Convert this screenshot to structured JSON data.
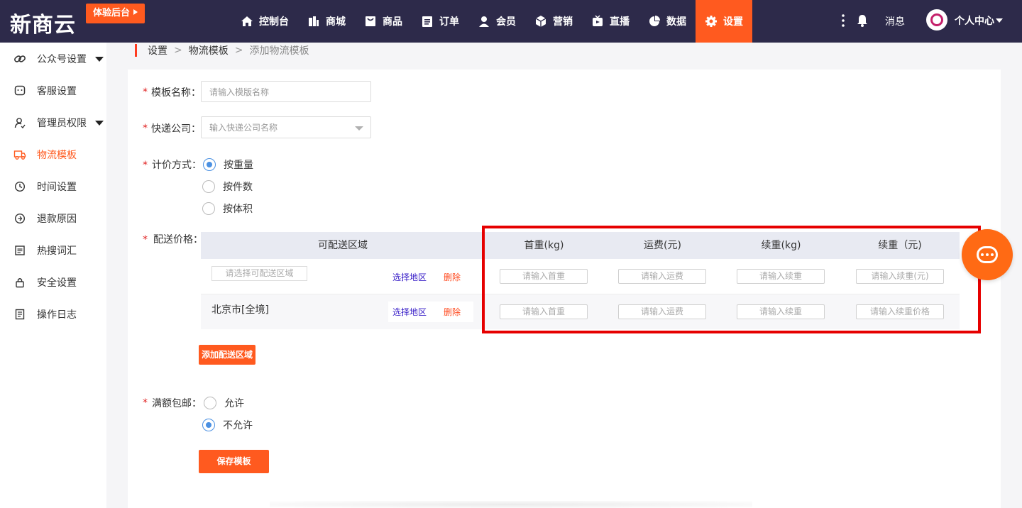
{
  "header": {
    "logo": "新商云",
    "trial_button": "体验后台",
    "nav": [
      {
        "label": "控制台",
        "icon": "home-icon"
      },
      {
        "label": "商城",
        "icon": "mall-icon"
      },
      {
        "label": "商品",
        "icon": "bag-icon"
      },
      {
        "label": "订单",
        "icon": "order-icon"
      },
      {
        "label": "会员",
        "icon": "user-icon"
      },
      {
        "label": "营销",
        "icon": "cube-icon"
      },
      {
        "label": "直播",
        "icon": "live-icon"
      },
      {
        "label": "数据",
        "icon": "pie-icon"
      },
      {
        "label": "设置",
        "icon": "gear-icon",
        "active": true
      }
    ],
    "messages_label": "消息",
    "user_center_label": "个人中心"
  },
  "sidebar": {
    "items": [
      {
        "label": "公众号设置",
        "icon": "link-icon",
        "expandable": true
      },
      {
        "label": "客服设置",
        "icon": "chat-icon"
      },
      {
        "label": "管理员权限",
        "icon": "admin-icon",
        "expandable": true
      },
      {
        "label": "物流模板",
        "icon": "truck-icon",
        "active": true
      },
      {
        "label": "时间设置",
        "icon": "clock-icon"
      },
      {
        "label": "退款原因",
        "icon": "refund-icon"
      },
      {
        "label": "热搜词汇",
        "icon": "list-icon"
      },
      {
        "label": "安全设置",
        "icon": "lock-icon"
      },
      {
        "label": "操作日志",
        "icon": "log-icon"
      }
    ]
  },
  "breadcrumb": {
    "items": [
      "设置",
      "物流模板",
      "添加物流模板"
    ],
    "separator": ">"
  },
  "form": {
    "template_name": {
      "label": "模板名称：",
      "placeholder": "请输入模版名称",
      "value": ""
    },
    "courier": {
      "label": "快递公司：",
      "placeholder": "输入快递公司名称",
      "value": ""
    },
    "pricing": {
      "label": "计价方式：",
      "options": [
        "按重量",
        "按件数",
        "按体积"
      ],
      "selected": "按重量"
    },
    "shipping_price": {
      "label": "配送价格：",
      "columns": [
        "可配送区域",
        "首重(kg)",
        "运费(元)",
        "续重(kg)",
        "续重（元)"
      ],
      "rows": [
        {
          "region_placeholder": "请选择可配送区域",
          "region": "",
          "select_label": "选择地区",
          "delete_label": "删除",
          "fields": [
            "请输入首重",
            "请输入运费",
            "请输入续重",
            "请输入续重(元)"
          ]
        },
        {
          "region": "北京市[全境]",
          "select_label": "选择地区",
          "delete_label": "删除",
          "fields": [
            "请输入首重",
            "请输入运费",
            "请输入续重",
            "请输入续重价格"
          ]
        }
      ],
      "add_button": "添加配送区域"
    },
    "free_shipping": {
      "label": "满额包邮：",
      "options": [
        "允许",
        "不允许"
      ],
      "selected": "不允许"
    },
    "save_button": "保存模板"
  },
  "colors": {
    "header_bg": "#2d2a4a",
    "accent": "#ff5a1f",
    "highlight_frame": "#e60000",
    "radio_checked": "#4a90e2"
  }
}
